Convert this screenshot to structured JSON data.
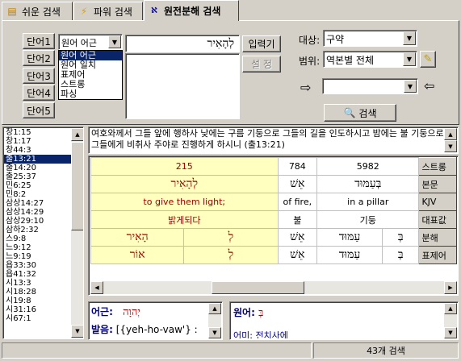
{
  "tabs": [
    {
      "label": "쉬운 검색",
      "icon": "book-icon"
    },
    {
      "label": "파워 검색",
      "icon": "lightning-icon"
    },
    {
      "label": "원전분해 검색",
      "icon": "hebrew-icon"
    }
  ],
  "words": [
    "단어1",
    "단어2",
    "단어3",
    "단어4",
    "단어5"
  ],
  "mode_select": {
    "value": "원어 어근",
    "options": [
      "원어 어근",
      "원어 일치",
      "표제어",
      "스트롱",
      "파싱"
    ]
  },
  "input_text": "לְהָאִיר",
  "input_button": "입력기",
  "settings_button": "설 정",
  "scope": {
    "target_label": "대상:",
    "target_value": "구약",
    "range_label": "범위:",
    "range_value": "역본별 전체"
  },
  "search_button": "검색",
  "references": [
    "창1:15",
    "창1:17",
    "창44:3",
    "출13:21",
    "출14:20",
    "출25:37",
    "민6:25",
    "민8:2",
    "삼상14:27",
    "삼상14:29",
    "삼상29:10",
    "삼하2:32",
    "스9:8",
    "느9:12",
    "느9:19",
    "욥33:30",
    "욥41:32",
    "시13:3",
    "시18:28",
    "시19:8",
    "시31:16",
    "시67:1"
  ],
  "selected_reference": "출13:21",
  "verse_text": "여호와께서 그들 앞에 행하사 낮에는 구름 기둥으로 그들의 길을 인도하시고 밤에는 불 기둥으로 그들에게 비취사 주야로 진행하게 하시니 (출13:21)",
  "analysis": {
    "strong": [
      "215",
      "784",
      "5982"
    ],
    "bonmun": [
      "לְהָאִיר",
      "אֵשׁ",
      "בְּעַמּוּד"
    ],
    "kjv": [
      "to give them light;",
      "of fire,",
      "in a pillar"
    ],
    "daepyo": [
      "밝게되다",
      "불",
      "기둥"
    ],
    "bunhae": [
      "הָאִיר",
      "לְ",
      "אֵשׁ",
      "עַמּוּד",
      "בְּ"
    ],
    "pyoje": [
      "אוֹר",
      "לְ",
      "אֵשׁ",
      "עַמּוּד",
      "בְּ"
    ],
    "row_labels": [
      "스트롱",
      "본문",
      "KJV",
      "대표값",
      "분해",
      "표제어"
    ]
  },
  "bottom_left": {
    "root_label": "어근:",
    "root_value": "יְהוָה",
    "pron_label": "발음:",
    "pron_value": "[{yeh-ho-vaw'} :"
  },
  "bottom_right": {
    "word_label": "원어:",
    "word_value": "בְּ",
    "partial_text": "어미: 전치사에"
  },
  "status": "43개 검색"
}
